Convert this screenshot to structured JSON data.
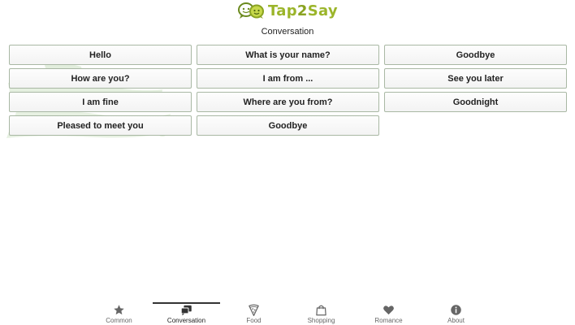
{
  "header": {
    "logo_text_part1": "Tap",
    "logo_text_part2": "2",
    "logo_text_part3": "Say",
    "page_title": "Conversation"
  },
  "colors": {
    "brand_green": "#9bb52a",
    "button_border": "#a9b8a4",
    "splash_green": "#cfe3c6"
  },
  "phrases": {
    "col1": [
      "Hello",
      "How are you?",
      "I am fine",
      "Pleased to meet you"
    ],
    "col2": [
      "What is your name?",
      "I am from ...",
      "Where are you from?",
      "Goodbye"
    ],
    "col3": [
      "Goodbye",
      "See you later",
      "Goodnight"
    ]
  },
  "nav": {
    "items": [
      {
        "label": "Common",
        "icon": "star-icon"
      },
      {
        "label": "Conversation",
        "icon": "chat-bubbles-icon"
      },
      {
        "label": "Food",
        "icon": "pizza-icon"
      },
      {
        "label": "Shopping",
        "icon": "shopping-bag-icon"
      },
      {
        "label": "Romance",
        "icon": "heart-icon"
      },
      {
        "label": "About",
        "icon": "info-icon"
      }
    ],
    "active": "Conversation"
  }
}
